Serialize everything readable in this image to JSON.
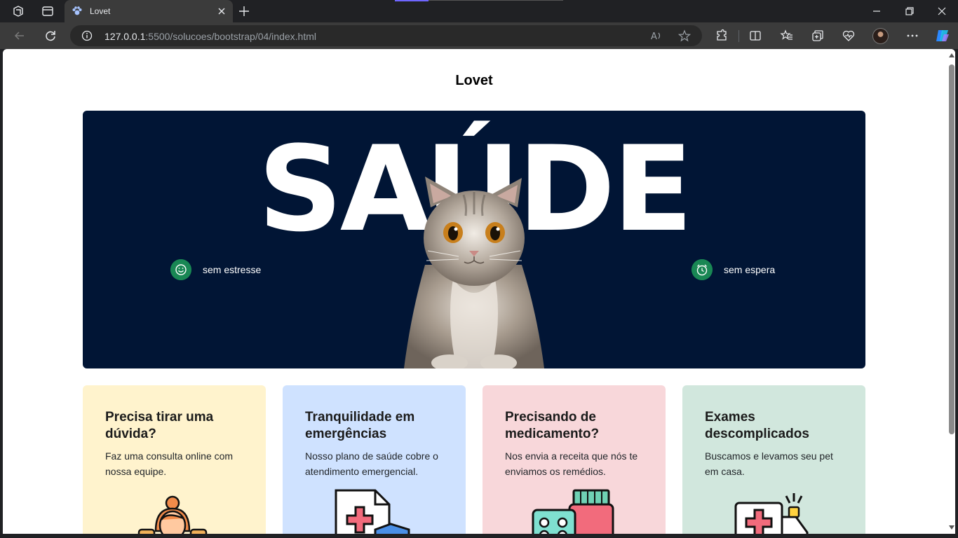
{
  "browser": {
    "tab_title": "Lovet",
    "address_host": "127.0.0.1",
    "address_path": ":5500/solucoes/bootstrap/04/index.html"
  },
  "page": {
    "brand": "Lovet",
    "hero": {
      "headline": "SAÚDE",
      "feature_left": "sem estresse",
      "feature_right": "sem espera",
      "bg_color": "#011535",
      "accent_color": "#198754"
    },
    "cards": [
      {
        "title": "Precisa tirar uma dúvida?",
        "text": "Faz uma consulta online com nossa equipe.",
        "bg": "#fff3cd"
      },
      {
        "title": "Tranquilidade em emergências",
        "text": "Nosso plano de saúde cobre o atendimento emergencial.",
        "bg": "#cfe2ff"
      },
      {
        "title": "Precisando de medicamento?",
        "text": "Nos envia a receita que nós te enviamos os remédios.",
        "bg": "#f8d7da"
      },
      {
        "title": "Exames descomplicados",
        "text": "Buscamos e levamos seu pet em casa.",
        "bg": "#d1e7dd"
      }
    ]
  }
}
